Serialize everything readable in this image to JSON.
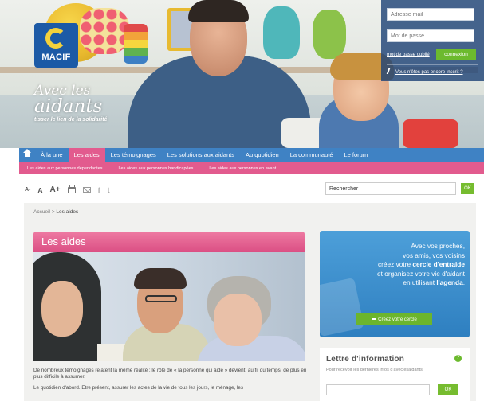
{
  "brand": {
    "logo_text": "MACIF",
    "tagline_line1": "Avec les",
    "tagline_line2": "aidants",
    "tagline_line3": "tisser le lien de la solidarité"
  },
  "login": {
    "email_placeholder": "Adresse mail",
    "password_placeholder": "Mot de passe",
    "forgot_label": "mot de passe oublié",
    "connect_label": "connexion",
    "register_label": "Vous n'êtes pas encore inscrit ?"
  },
  "nav": {
    "items": [
      "À la une",
      "Les aides",
      "Les témoignages",
      "Les solutions aux aidants",
      "Au quotidien",
      "La communauté",
      "Le forum"
    ],
    "active_index": 1
  },
  "subnav": {
    "items": [
      "Les aides aux personnes dépendantes",
      "Les aides aux personnes handicapées",
      "Les aides aux personnes en avant"
    ]
  },
  "toolbar": {
    "font_small": "A-",
    "font_normal": "A",
    "font_large": "A+",
    "facebook_glyph": "f",
    "twitter_glyph": "t"
  },
  "search": {
    "value": "Rechercher",
    "button_label": "OK"
  },
  "breadcrumb": {
    "home": "Accueil",
    "separator": ">",
    "current": "Les aides"
  },
  "article": {
    "title": "Les aides",
    "paragraph1": "De nombreux témoignages relatent la même réalité : le rôle de « la personne qui aide » devient, au fil du temps, de plus en plus difficile à assumer.",
    "paragraph2": "Le quotidien d'abord. Etre présent, assurer les actes de la vie de tous les jours, le ménage, les"
  },
  "promo": {
    "line1": "Avec vos proches,",
    "line2": "vos amis, vos voisins",
    "line3_pre": "créez votre ",
    "line3_bold": "cercle d'entraide",
    "line4": "et organisez votre vie d'aidant",
    "line5_pre": "en utilisant ",
    "line5_bold": "l'agenda",
    "line5_post": ".",
    "button_label": "Créez votre cercle"
  },
  "newsletter": {
    "title": "Lettre d'information",
    "help_glyph": "?",
    "subtitle": "Pour recevoir les dernières infos d'aveclesaidants",
    "button_label": "OK"
  },
  "colors": {
    "nav_blue": "#3f82c4",
    "accent_pink": "#e25b8e",
    "green_button": "#6cba2e",
    "logo_blue": "#1c5aa6",
    "logo_yellow": "#f4d13b"
  }
}
